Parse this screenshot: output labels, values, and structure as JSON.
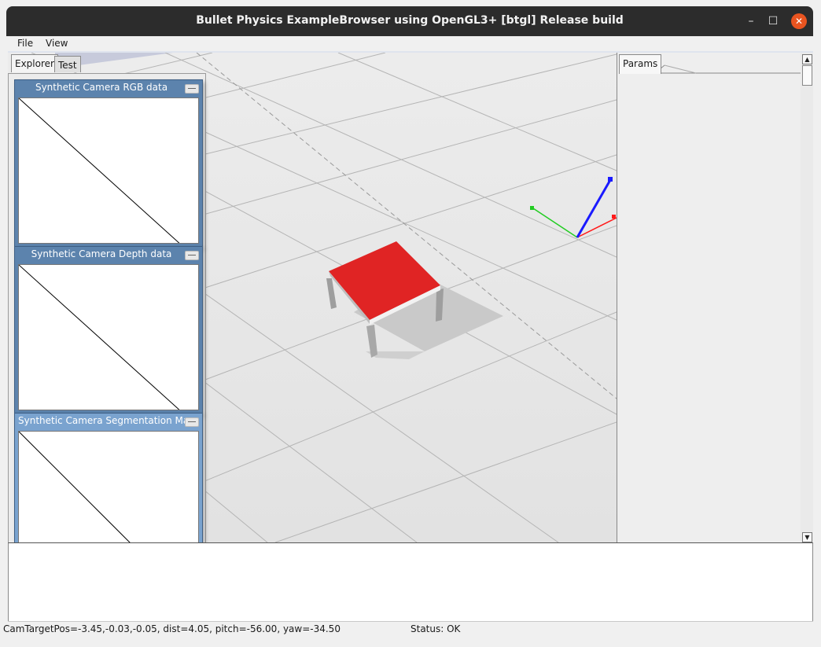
{
  "window": {
    "title": "Bullet Physics ExampleBrowser using OpenGL3+ [btgl] Release build",
    "controls": {
      "minimize": "–",
      "maximize": "☐",
      "close": "✕"
    },
    "close_color": "#e95420"
  },
  "menu": {
    "items": [
      "File",
      "View"
    ]
  },
  "explorer": {
    "tabs": [
      "Explorer",
      "Test"
    ],
    "active_tab": "Explorer"
  },
  "camera_windows": [
    {
      "title": "Synthetic Camera RGB data"
    },
    {
      "title": "Synthetic Camera Depth data"
    },
    {
      "title": "Synthetic Camera Segmentation Mask"
    }
  ],
  "params": {
    "tab_label": "Params"
  },
  "scene": {
    "table_top_color": "#e02424",
    "floor_color": "#e8e8e8",
    "axis_colors": {
      "x": "#ff1a1a",
      "y": "#22cc22",
      "z": "#1a1aff"
    }
  },
  "status": {
    "camera": "CamTargetPos=-3.45,-0.03,-0.05, dist=4.05, pitch=-56.00, yaw=-34.50",
    "state": "Status: OK"
  }
}
